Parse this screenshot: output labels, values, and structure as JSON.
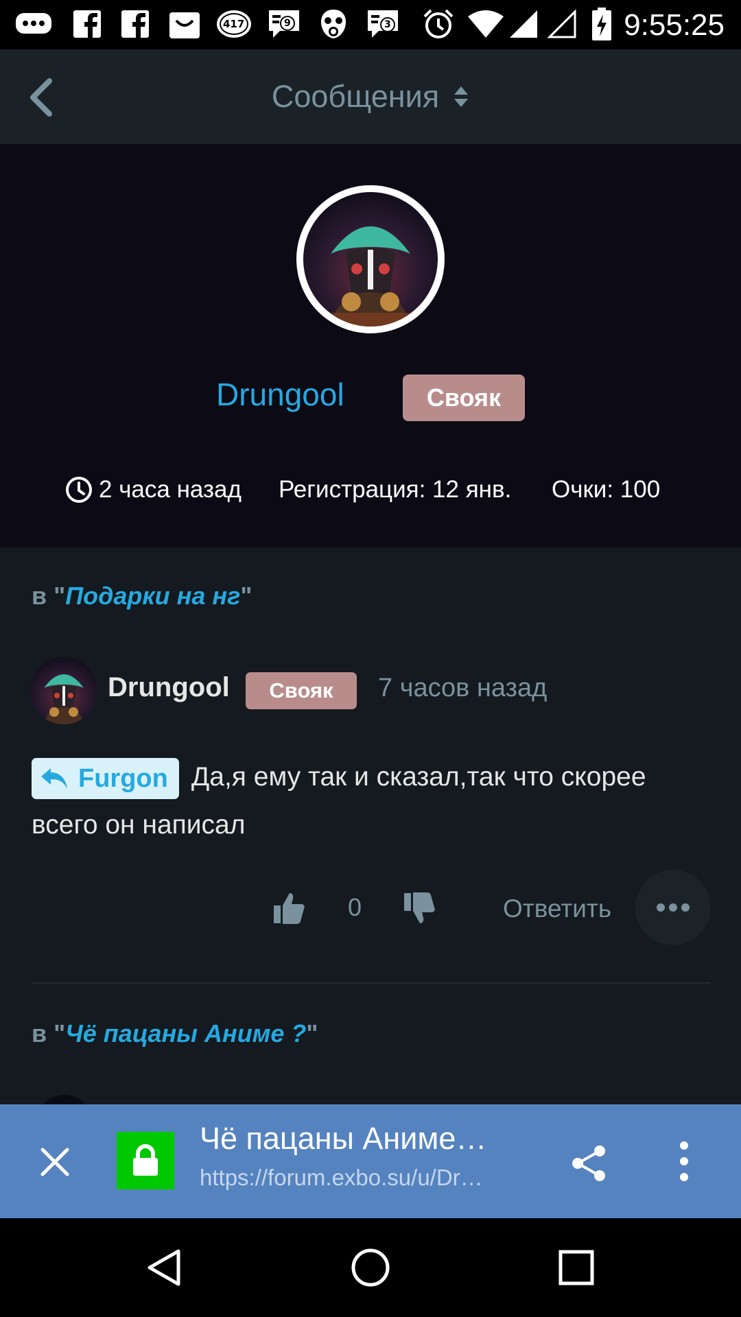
{
  "status_bar": {
    "time": "9:55:25",
    "notification_count_1": "417",
    "notification_count_2": "9",
    "notification_count_3": "3",
    "icons": [
      "messenger-icon",
      "facebook-icon",
      "facebook-icon",
      "shopping-bag-icon",
      "badge-417-icon",
      "chat-9-icon",
      "gasmask-icon",
      "chat-3-icon",
      "alarm-icon",
      "wifi-icon",
      "signal-icon",
      "signal-empty-icon",
      "battery-charging-icon"
    ]
  },
  "app_bar": {
    "title": "Сообщения"
  },
  "profile": {
    "username": "Drungool",
    "group": "Свояк",
    "last_seen": "2 часа назад",
    "registration": "Регистрация: 12 янв.",
    "points": "Очки: 100"
  },
  "posts": [
    {
      "discussion_prefix": "в \"",
      "discussion_title": "Подарки на нг",
      "discussion_suffix": "\"",
      "author": "Drungool",
      "group": "Свояк",
      "time": "7 часов назад",
      "mention": "Furgon",
      "text": "Да,я ему так и сказал,так что скорее всего он написал",
      "likes": "0",
      "reply_label": "Ответить"
    }
  ],
  "next_discussion": {
    "prefix": "в \"",
    "title": "Чё пацаны Аниме ?",
    "suffix": "\""
  },
  "custom_tab": {
    "title": "Чё пацаны Аниме…",
    "url": "https://forum.exbo.su/u/Dr…"
  },
  "colors": {
    "accent": "#26a9e0",
    "badge": "#b98c8c",
    "secure": "#00c800",
    "tab_bar": "#5583bf"
  }
}
